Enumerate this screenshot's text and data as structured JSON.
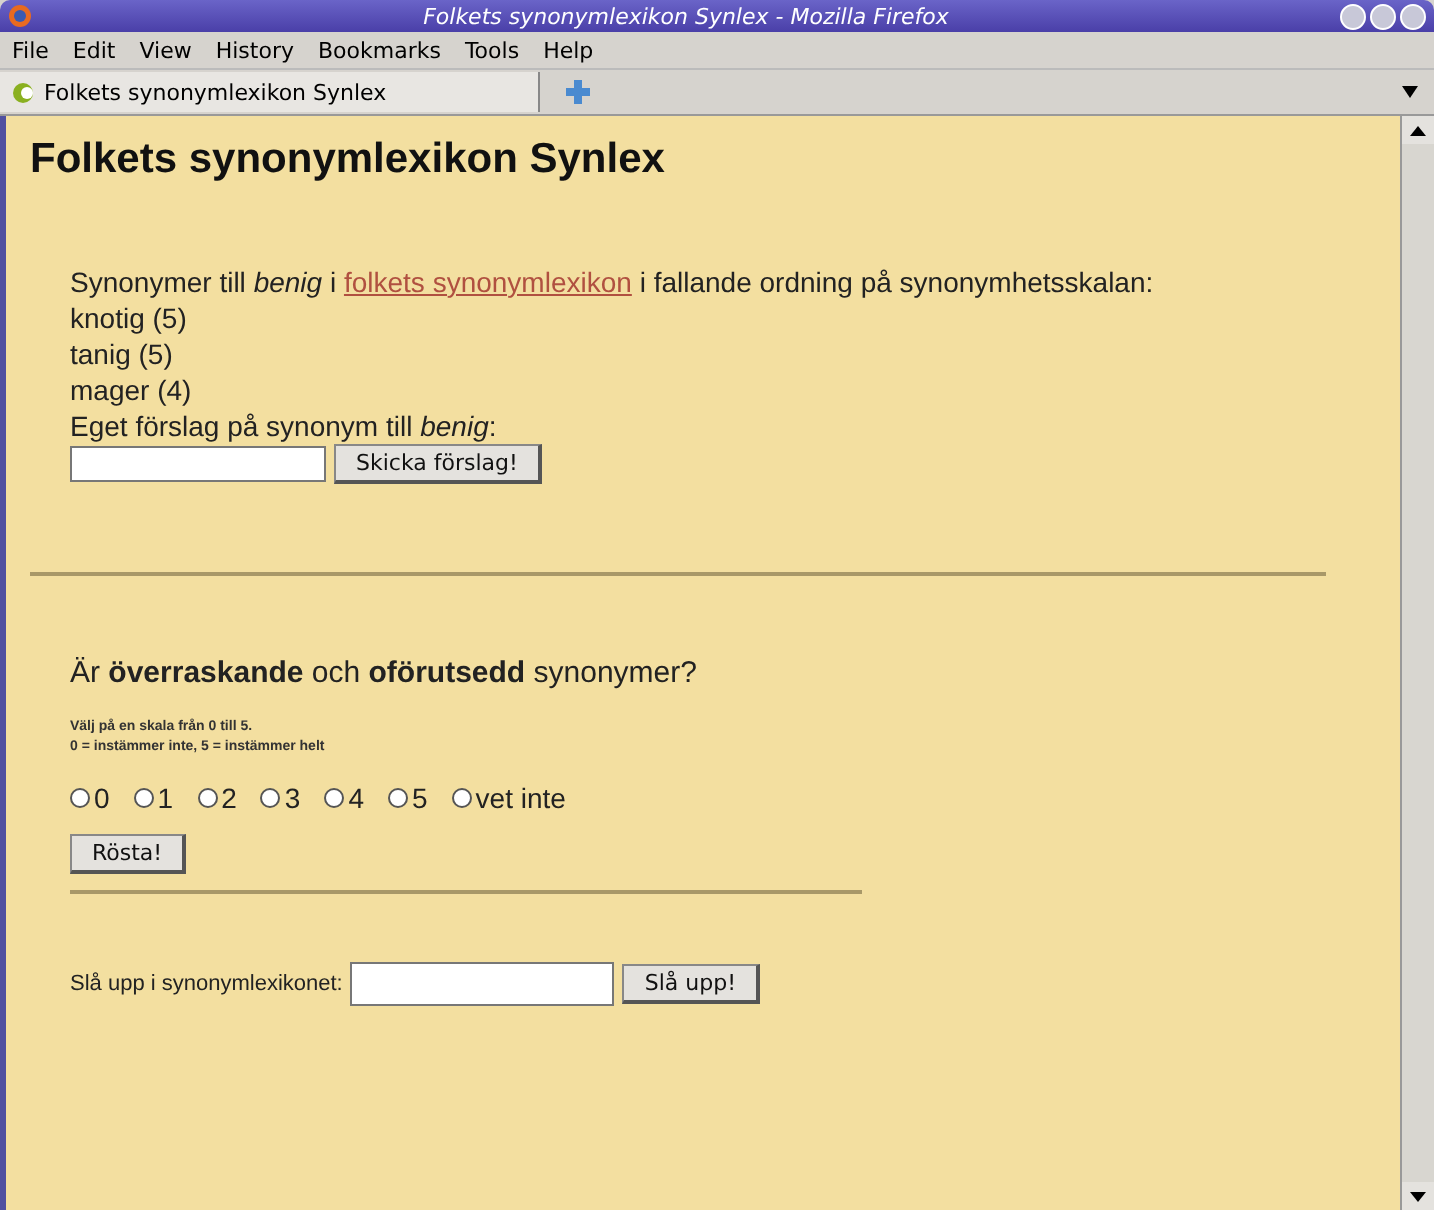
{
  "window": {
    "title": "Folkets synonymlexikon Synlex - Mozilla Firefox"
  },
  "menu": [
    "File",
    "Edit",
    "View",
    "History",
    "Bookmarks",
    "Tools",
    "Help"
  ],
  "tabs": [
    {
      "label": "Folkets synonymlexikon Synlex",
      "selected": true
    }
  ],
  "page": {
    "heading": "Folkets synonymlexikon Synlex",
    "intro": {
      "before": "Synonymer till *benig* i",
      "link": "folkets synonymlexikon",
      "after": "i fallande ordning på synonymhetsskalan:"
    },
    "synonyms": [
      "knotig (5)",
      "tanig (5)",
      "mager (4)"
    ],
    "suggest_label": "Eget förslag på synonym till *benig*:",
    "suggest_button": "Skicka förslag!",
    "question": "Är **överraskande** och **oförutsedd** synonymer?",
    "scale_lines": [
      "Välj på en skala från 0 till 5.",
      "0 = instämmer inte,   5 = instämmer helt"
    ],
    "options": [
      {
        "label": "0",
        "selected": false
      },
      {
        "label": "1",
        "selected": false
      },
      {
        "label": "2",
        "selected": false
      },
      {
        "label": "3",
        "selected": false
      },
      {
        "label": "4",
        "selected": false
      },
      {
        "label": "5",
        "selected": false
      },
      {
        "label": "vet inte",
        "selected": false
      }
    ],
    "vote_button": "Rösta!",
    "lookup_label": "Slå upp i synonymlexikonet:",
    "lookup_button": "Slå upp!"
  }
}
